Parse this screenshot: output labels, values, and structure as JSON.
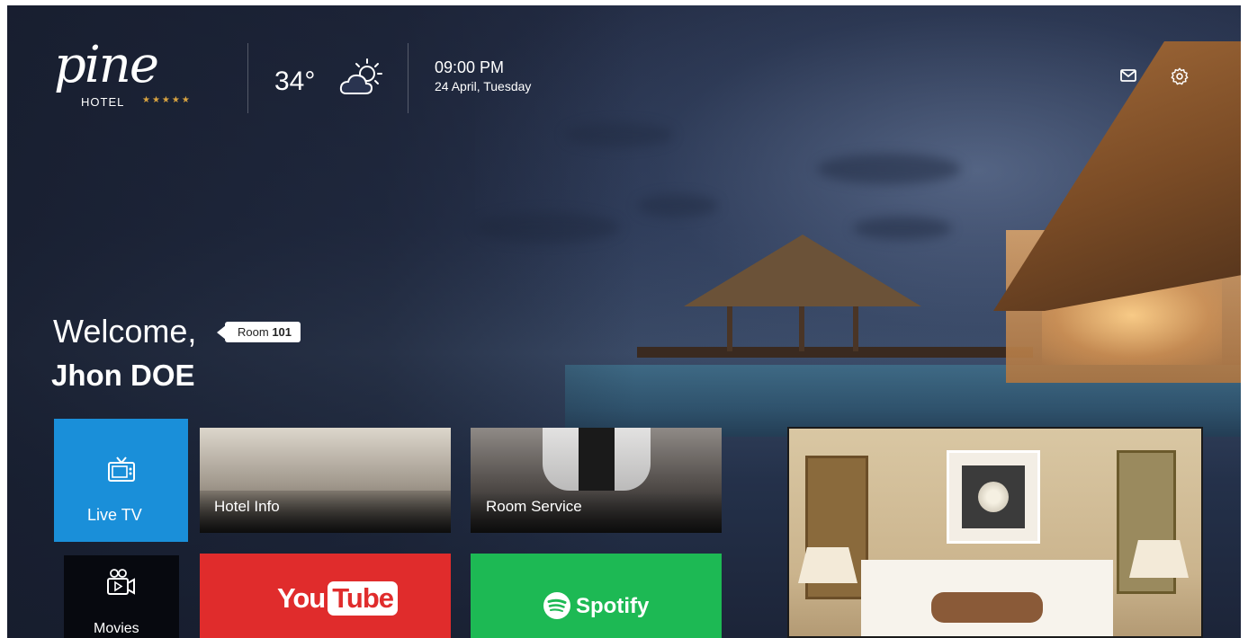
{
  "brand": {
    "logo_script": "pine",
    "logo_hotel": "HOTEL",
    "stars": "★★★★★",
    "star_color": "#d9a441"
  },
  "weather": {
    "temperature": "34°",
    "icon": "partly-cloudy-day-icon"
  },
  "clock": {
    "time": "09:00 PM",
    "date": "24 April, Tuesday"
  },
  "header_actions": [
    {
      "icon": "mail-icon"
    },
    {
      "icon": "settings-gear-icon"
    }
  ],
  "welcome": {
    "greeting": "Welcome,",
    "room_label": "Room",
    "room_number": "101",
    "guest_name": "Jhon DOE"
  },
  "tiles": {
    "live_tv": {
      "label": "Live TV",
      "icon": "tv-icon",
      "color": "#1a8fd9"
    },
    "movies": {
      "label": "Movies",
      "icon": "movie-camera-icon",
      "color": "#07090f"
    },
    "hotel_info": {
      "label": "Hotel Info"
    },
    "room_service": {
      "label": "Room Service"
    },
    "youtube": {
      "label_you": "You",
      "label_tube": "Tube",
      "color": "#e02c2c"
    },
    "spotify": {
      "label": "Spotify",
      "color": "#1db954"
    }
  }
}
